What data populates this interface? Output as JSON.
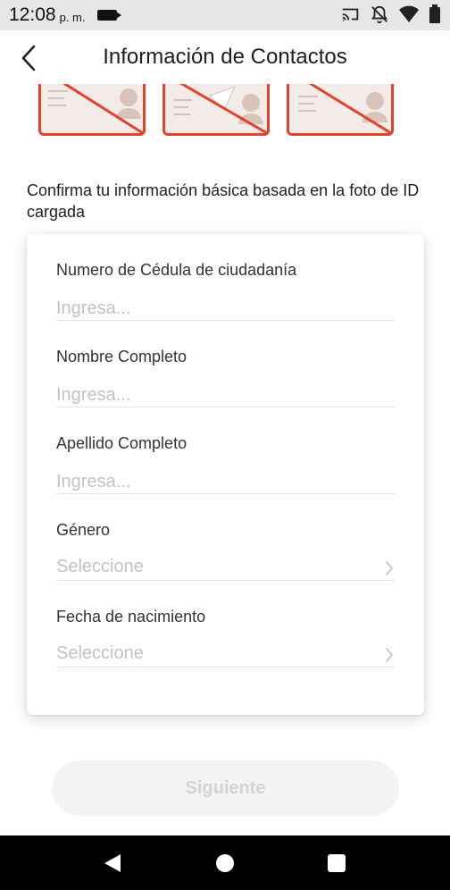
{
  "status_bar": {
    "time": "12:08",
    "ampm": "p. m."
  },
  "header": {
    "title": "Información de Contactos"
  },
  "intro": {
    "text": "Confirma tu información básica basada en la foto de ID cargada"
  },
  "form": {
    "cedula": {
      "label": "Numero de Cédula de ciudadanía",
      "placeholder": "Ingresa..."
    },
    "nombre": {
      "label": "Nombre Completo",
      "placeholder": "Ingresa..."
    },
    "apellido": {
      "label": "Apellido Completo",
      "placeholder": "Ingresa..."
    },
    "genero": {
      "label": "Género",
      "value": "Seleccione"
    },
    "fecha": {
      "label": "Fecha de nacimiento",
      "value": "Seleccione"
    }
  },
  "actions": {
    "next_label": "Siguiente"
  },
  "colors": {
    "accent_red": "#e2432b",
    "placeholder": "#c2c2c2",
    "disabled_button_bg": "#f3f3f3",
    "disabled_button_text": "#d3d3d3"
  },
  "icons": {
    "back": "chevron-left-icon",
    "select": "chevron-right-icon",
    "cast": "cast-icon",
    "notifications_off": "bell-off-icon",
    "wifi": "wifi-icon",
    "battery": "battery-icon"
  }
}
